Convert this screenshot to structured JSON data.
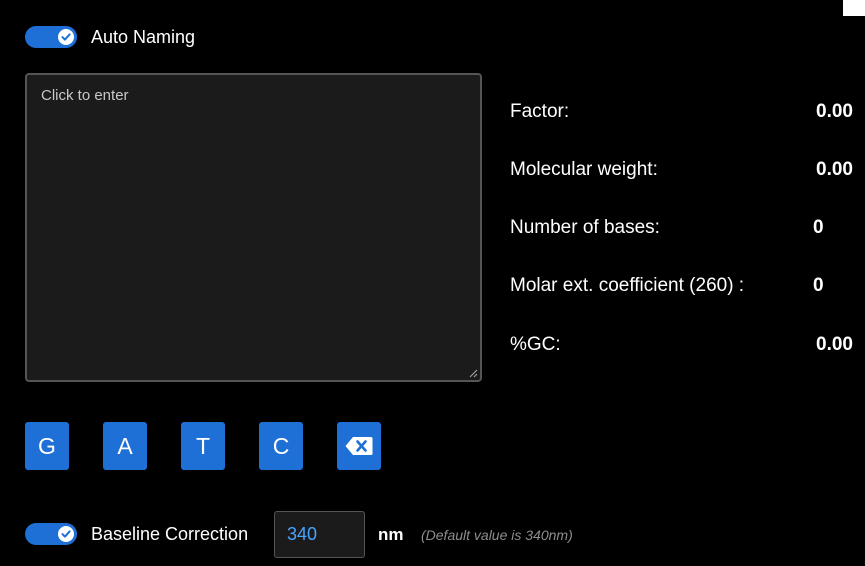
{
  "auto_naming": {
    "label": "Auto Naming",
    "enabled": true
  },
  "sequence_input": {
    "placeholder": "Click to enter",
    "value": ""
  },
  "stats": {
    "factor": {
      "label": "Factor:",
      "value": "0.00"
    },
    "molecular_weight": {
      "label": "Molecular weight:",
      "value": "0.00"
    },
    "number_of_bases": {
      "label": "Number of bases:",
      "value": "0"
    },
    "molar_ext": {
      "label": "Molar ext. coefficient (260) :",
      "value": "0"
    },
    "gc": {
      "label": "%GC:",
      "value": "0.00"
    }
  },
  "base_buttons": {
    "g": "G",
    "a": "A",
    "t": "T",
    "c": "C",
    "backspace_icon": "backspace-icon"
  },
  "baseline_correction": {
    "label": "Baseline Correction",
    "enabled": true,
    "value": "340",
    "unit": "nm",
    "hint": "(Default value is 340nm)"
  },
  "colors": {
    "accent": "#1e6fd6",
    "value_text": "#4aa3ff",
    "background": "#000000",
    "hint": "#8e8e8e"
  }
}
